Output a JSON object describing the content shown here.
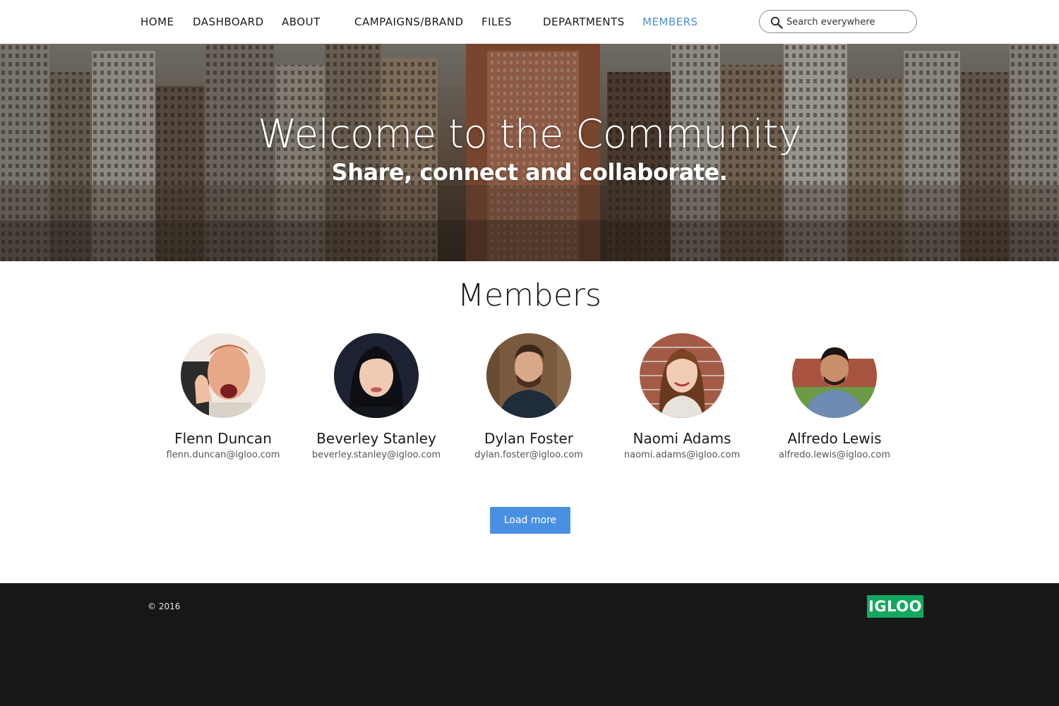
{
  "nav": {
    "items": [
      {
        "label": "HOME",
        "active": false
      },
      {
        "label": "DASHBOARD",
        "active": false
      },
      {
        "label": "ABOUT",
        "active": false
      },
      {
        "label": "CAMPAIGNS/BRAND",
        "active": false
      },
      {
        "label": "FILES",
        "active": false
      },
      {
        "label": "DEPARTMENTS",
        "active": false
      },
      {
        "label": "MEMBERS",
        "active": true
      }
    ],
    "search_placeholder": "Search everywhere",
    "search_icon": "search-icon",
    "active_color": "#4a90d9"
  },
  "hero": {
    "title": "Welcome to the Community",
    "subtitle": "Share, connect and collaborate."
  },
  "members": {
    "title": "Members",
    "list": [
      {
        "name": "Flenn Duncan",
        "email": "flenn.duncan@igloo.com"
      },
      {
        "name": "Beverley Stanley",
        "email": "beverley.stanley@igloo.com"
      },
      {
        "name": "Dylan Foster",
        "email": "dylan.foster@igloo.com"
      },
      {
        "name": "Naomi Adams",
        "email": "naomi.adams@igloo.com"
      },
      {
        "name": "Alfredo Lewis",
        "email": "alfredo.lewis@igloo.com"
      }
    ],
    "load_more_label": "Load more",
    "button_color": "#4a90e2"
  },
  "footer": {
    "copyright": "© 2016",
    "logo_text": "IGLOO",
    "logo_color": "#13a860",
    "background": "#171717"
  }
}
